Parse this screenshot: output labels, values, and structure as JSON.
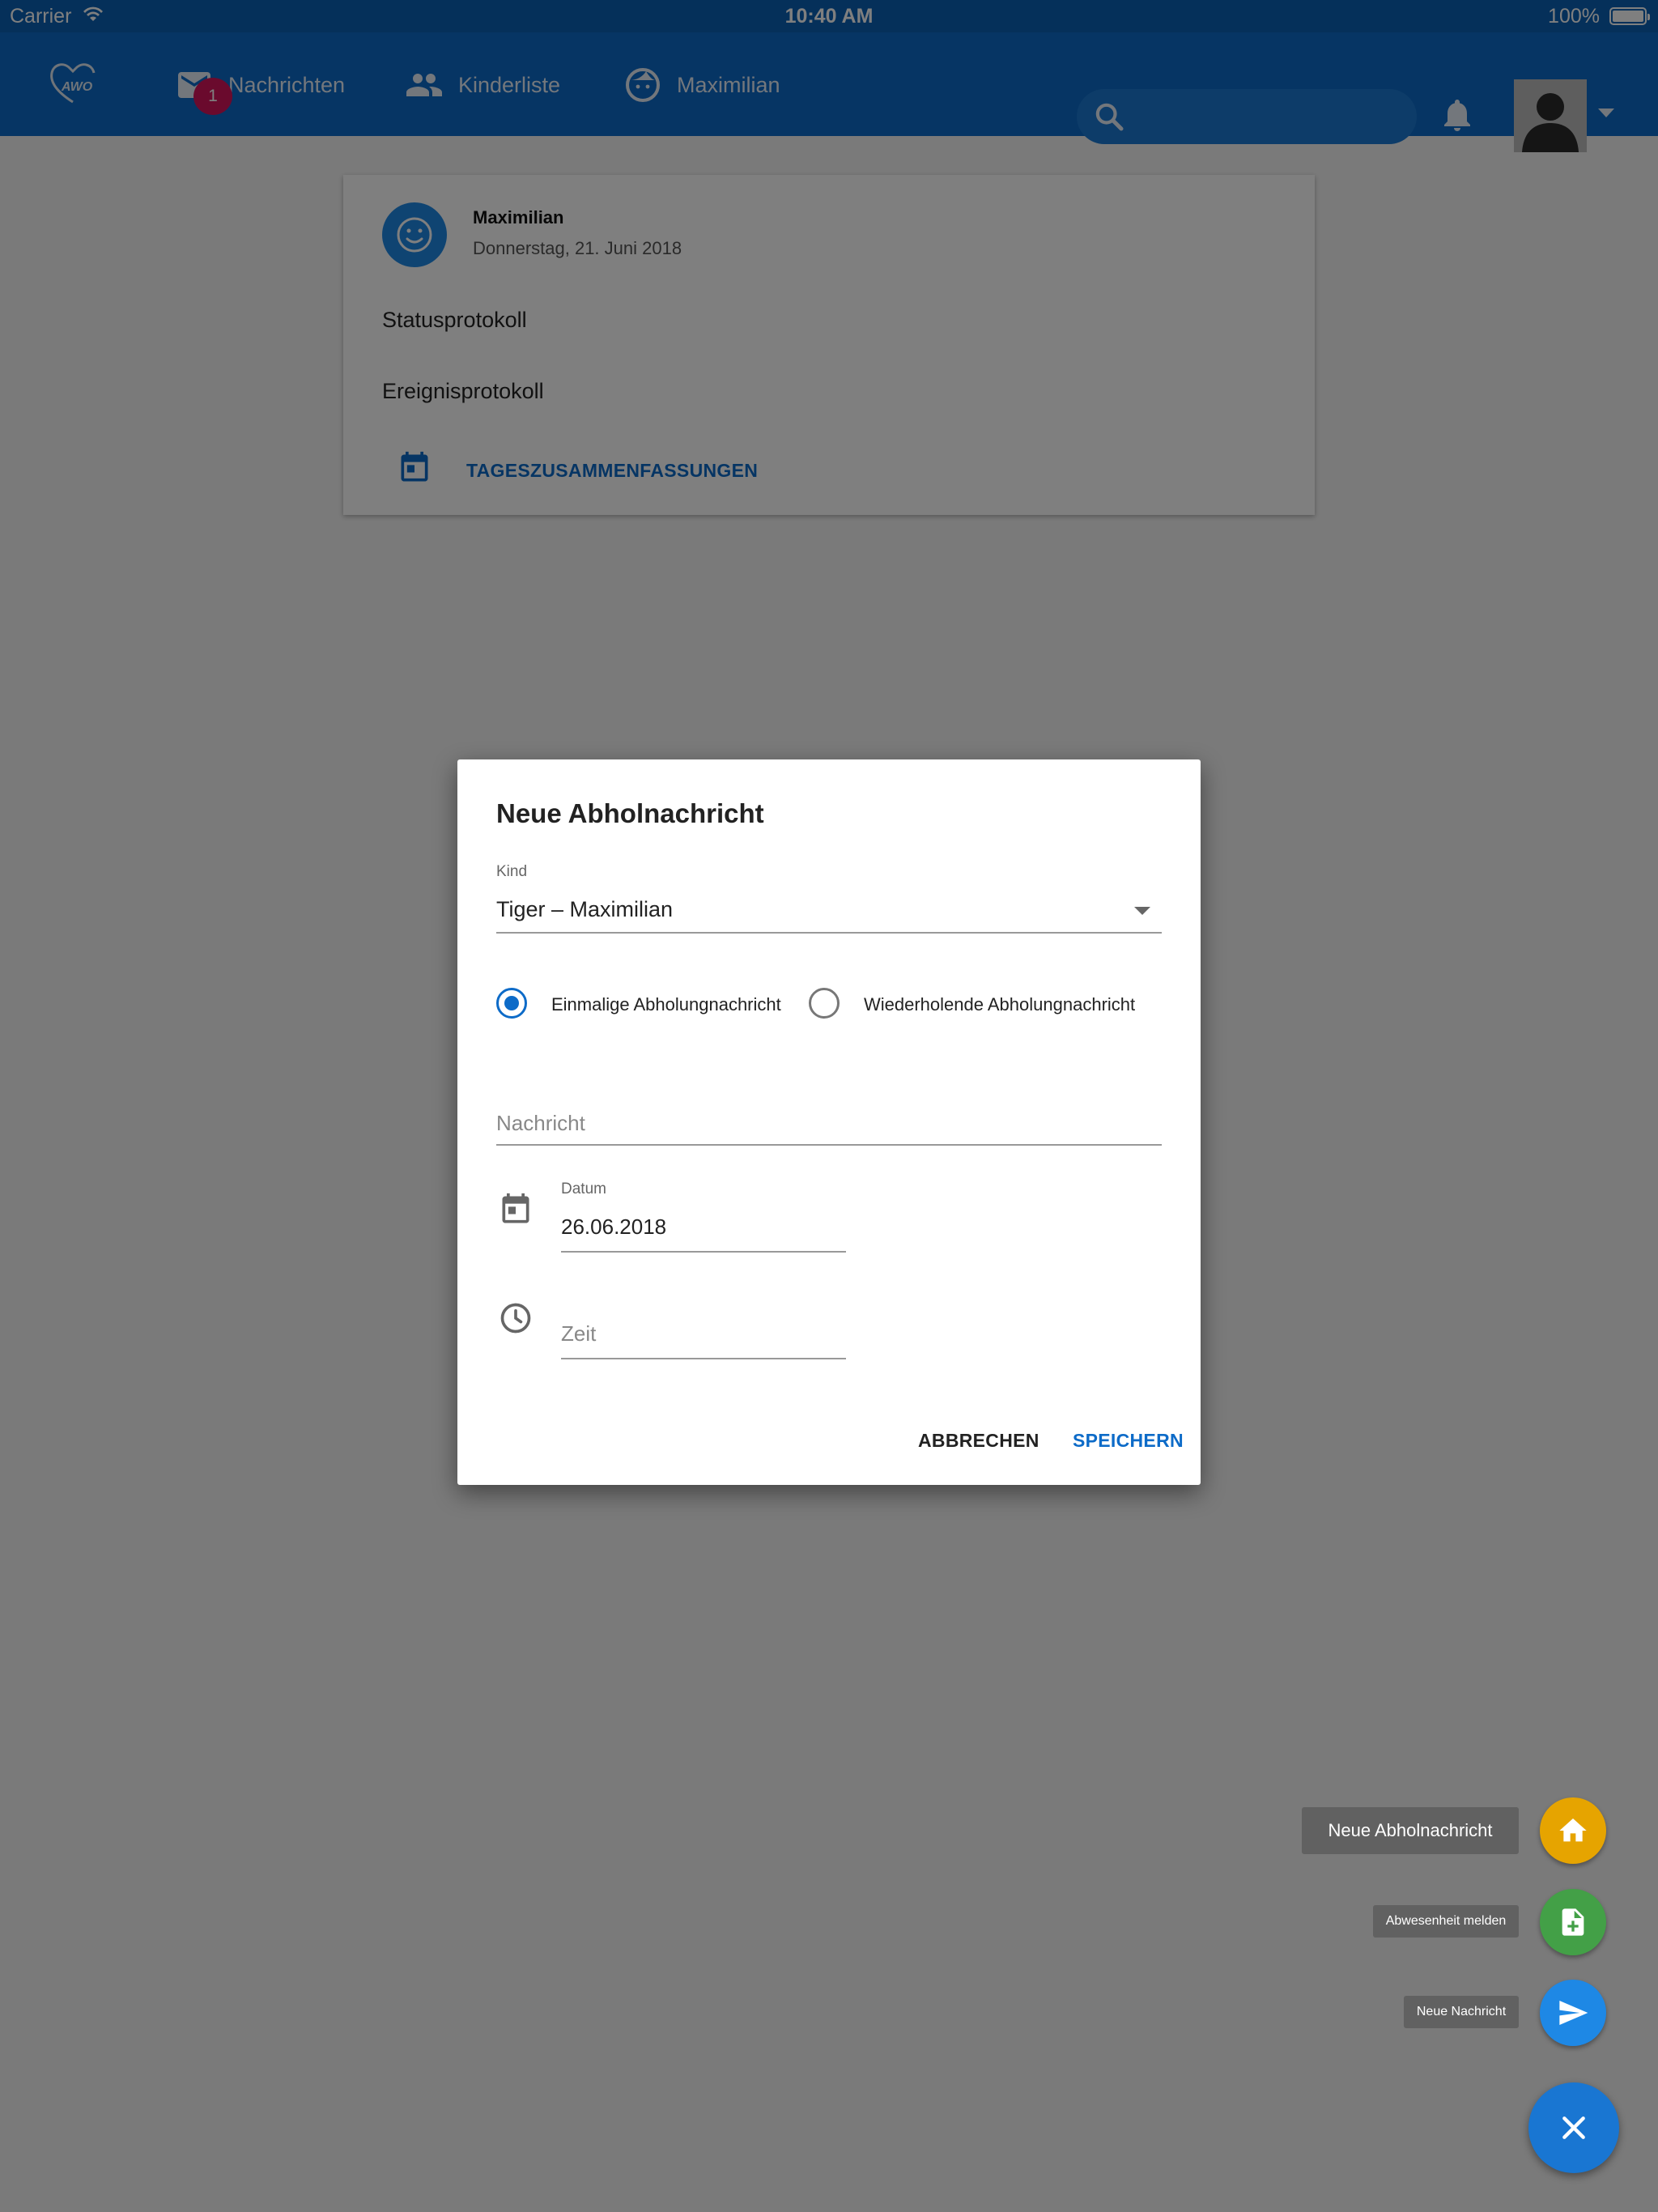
{
  "status_bar": {
    "carrier": "Carrier",
    "time": "10:40 AM",
    "battery": "100%"
  },
  "nav": {
    "messages_label": "Nachrichten",
    "messages_badge": "1",
    "children_label": "Kinderliste",
    "child_label": "Maximilian"
  },
  "card": {
    "child_name": "Maximilian",
    "date": "Donnerstag, 21. Juni 2018",
    "status_log": "Statusprotokoll",
    "event_log": "Ereignisprotokoll",
    "summaries_link": "TAGESZUSAMMENFASSUNGEN"
  },
  "dialog": {
    "title": "Neue Abholnachricht",
    "child_field_label": "Kind",
    "child_value": "Tiger – Maximilian",
    "radio_once": "Einmalige Abholungnachricht",
    "radio_repeat": "Wiederholende Abholungnachricht",
    "radio_once_selected": true,
    "message_placeholder": "Nachricht",
    "date_label": "Datum",
    "date_value": "26.06.2018",
    "time_placeholder": "Zeit",
    "cancel_label": "ABBRECHEN",
    "save_label": "SPEICHERN"
  },
  "fab": {
    "action1_label": "Neue Abholnachricht",
    "action2_label": "Abwesenheit melden",
    "action3_label": "Neue Nachricht",
    "action1_icon": "home-icon",
    "action2_icon": "note-add-icon",
    "action3_icon": "send-icon",
    "main_icon": "close-icon"
  },
  "colors": {
    "primary": "#0d6bc8",
    "badge": "#d4145a",
    "fab_yellow": "#e6a400",
    "fab_green": "#43a047",
    "fab_blue": "#1e88e5"
  }
}
